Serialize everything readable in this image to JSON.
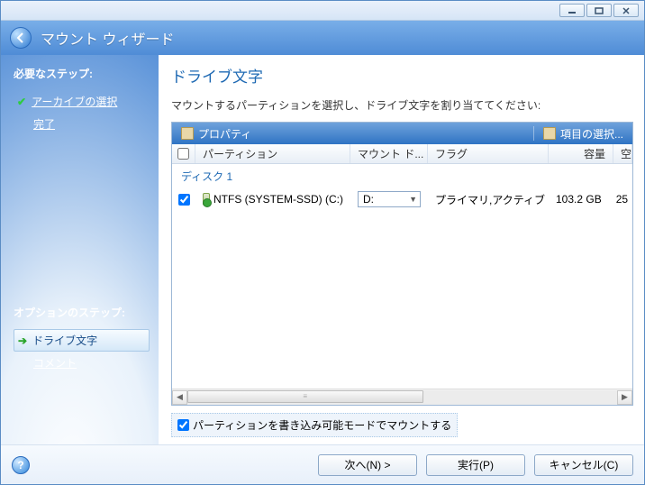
{
  "window": {
    "title": "マウント ウィザード"
  },
  "sidebar": {
    "required_label": "必要なステップ:",
    "items": [
      {
        "label": "アーカイブの選択",
        "done": true,
        "link": true
      },
      {
        "label": "完了",
        "done": false,
        "link": true
      }
    ],
    "optional_label": "オプションのステップ:",
    "optional_items": [
      {
        "label": "ドライブ文字",
        "current": true
      },
      {
        "label": "コメント",
        "link": true
      }
    ]
  },
  "main": {
    "title": "ドライブ文字",
    "instruction": "マウントするパーティションを選択し、ドライブ文字を割り当ててください:",
    "toolbar": {
      "properties": "プロパティ",
      "columns": "項目の選択..."
    },
    "columns": {
      "partition": "パーティション",
      "mount": "マウント ド...",
      "flag": "フラグ",
      "capacity": "容量",
      "free": "空"
    },
    "groups": [
      {
        "name": "ディスク 1",
        "rows": [
          {
            "checked": true,
            "name": "NTFS (SYSTEM-SSD) (C:)",
            "mount": "D:",
            "flag": "プライマリ,アクティブ",
            "capacity": "103.2 GB",
            "free": "25"
          }
        ]
      }
    ],
    "writable": {
      "checked": true,
      "label": "パーティションを書き込み可能モードでマウントする"
    }
  },
  "footer": {
    "next": "次へ(N) >",
    "run": "実行(P)",
    "cancel": "キャンセル(C)"
  }
}
